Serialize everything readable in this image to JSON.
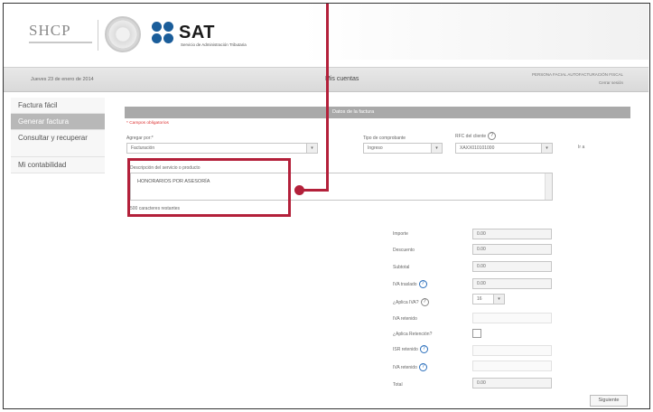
{
  "header": {
    "shcp_logo": "SHCP",
    "sat_logo": "SAT",
    "sat_subtitle": "Servicio de Administración Tributaria"
  },
  "datebar": {
    "date": "Jueves 23 de enero de 2014",
    "title": "Mis cuentas",
    "right_line1": "PERSONA FACIAL AUTOFACTURACIÓN FISCAL",
    "right_line2": "Cerrar sesión"
  },
  "sidebar": {
    "items": [
      {
        "label": "Factura fácil"
      },
      {
        "label": "Generar factura",
        "active": true
      },
      {
        "label": "Consultar y recuperar"
      },
      {
        "label": "Mi contabilidad"
      }
    ]
  },
  "form": {
    "panel_title": "Datos de la factura",
    "required_note": "* Campos obligatorios",
    "fields": {
      "concepto_label": "Agregar por:*",
      "concepto_value": "Facturación",
      "tipo_label": "Tipo de comprobante",
      "tipo_value": "Ingreso",
      "rfc_label": "RFC del cliente",
      "rfc_value": "XAXX010101000",
      "extra": "Ir a"
    },
    "description": {
      "label": "Descripción del servicio o producto",
      "value": "HONORARIOS POR ASESORÍA",
      "counter": "500 caracteres restantes"
    }
  },
  "totals": {
    "rows": [
      {
        "label": "Importe",
        "value": "0.00"
      },
      {
        "label": "Descuento",
        "value": "0.00"
      },
      {
        "label": "Subtotal",
        "value": "0.00"
      },
      {
        "label": "IVA traslado",
        "value": "0.00",
        "help": true
      },
      {
        "label": "¿Aplica IVA?",
        "value": "",
        "help": true
      },
      {
        "label": "IVA retenido",
        "value": ""
      },
      {
        "label": "¿Aplica Retención?",
        "value": ""
      },
      {
        "label": "ISR retenido",
        "value": "",
        "help": true
      },
      {
        "label": "IVA retenido",
        "value": "",
        "help": true
      },
      {
        "label": "Total",
        "value": "0.00"
      }
    ],
    "aplica_iva_value": "16",
    "aplica_iva_caret": "▾"
  },
  "actions": {
    "next_label": "Siguiente"
  },
  "colors": {
    "highlight": "#b3203a",
    "sat_blue": "#1a5d9a"
  }
}
